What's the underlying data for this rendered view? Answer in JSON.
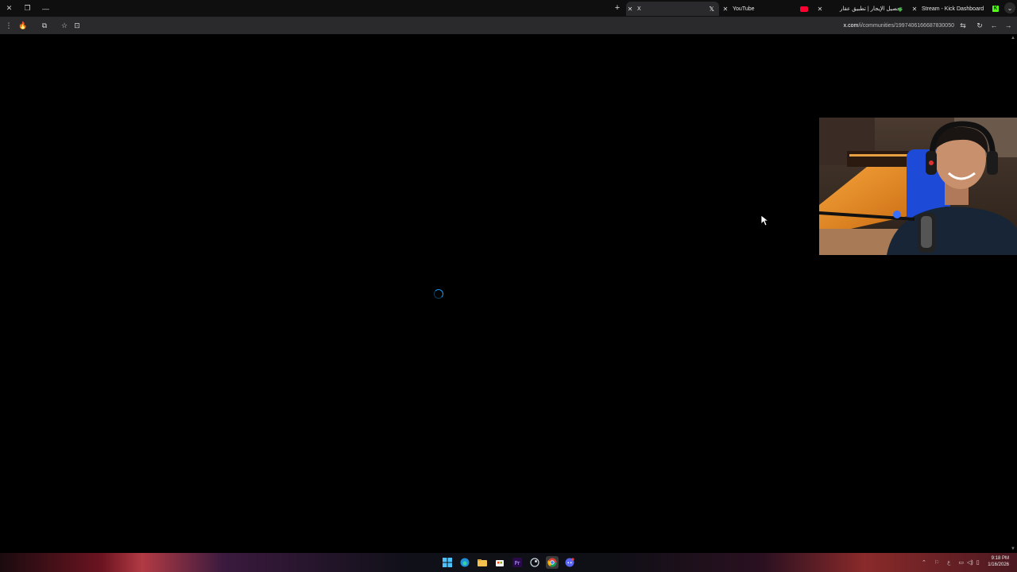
{
  "browser": {
    "tabs": [
      {
        "title": "Stream - Kick Dashboard",
        "favicon": "kick-icon"
      },
      {
        "title": "تحصيل الإيجار | تطبيق عقار",
        "favicon": "aqar-icon"
      },
      {
        "title": "YouTube",
        "favicon": "youtube-icon"
      },
      {
        "title": "X",
        "favicon": "x-icon",
        "active": true
      }
    ],
    "url": {
      "host": "x.com",
      "path": "/i/communities/1997406166687830050"
    }
  },
  "page": {
    "state": "loading",
    "spinner_color": "#1d9bf0",
    "background": "#000000"
  },
  "webcam_overlay": {
    "description_icon": "webcam-feed"
  },
  "taskbar": {
    "apps": [
      "windows-start-icon",
      "edge-icon",
      "file-explorer-icon",
      "store-icon",
      "premiere-icon",
      "steam-icon",
      "chrome-icon",
      "discord-icon"
    ],
    "clock": {
      "time": "9:18 PM",
      "date": "1/16/2026"
    }
  },
  "colors": {
    "accent": "#1d9bf0",
    "tab_active": "#2a2a2c",
    "tabstrip": "#0f0f10"
  }
}
